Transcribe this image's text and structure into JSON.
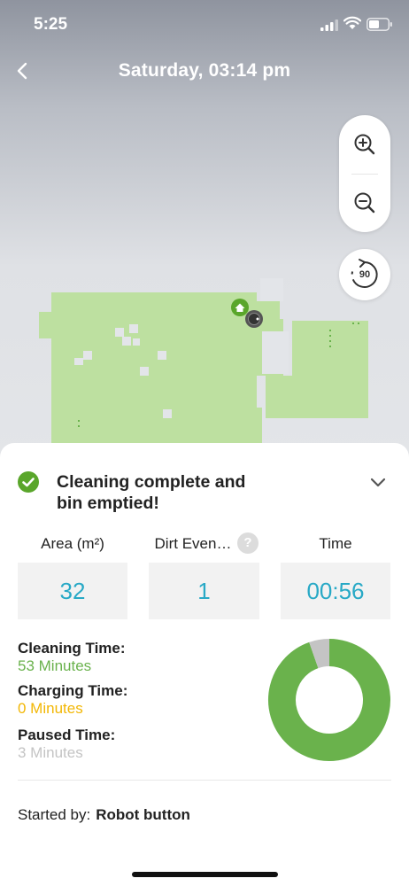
{
  "status_bar": {
    "time": "5:25"
  },
  "header": {
    "title": "Saturday, 03:14 pm"
  },
  "map_controls": {
    "rotate_label": "90"
  },
  "summary": {
    "title_line1": "Cleaning complete and",
    "title_line2": "bin emptied!"
  },
  "stats": [
    {
      "label": "Area (m²)",
      "value": "32"
    },
    {
      "label": "Dirt Even…",
      "value": "1"
    },
    {
      "label": "Time",
      "value": "00:56"
    }
  ],
  "help_glyph": "?",
  "details": {
    "cleaning": {
      "label": "Cleaning Time:",
      "value": "53 Minutes",
      "minutes": 53,
      "color": "#6ab24c"
    },
    "charging": {
      "label": "Charging Time:",
      "value": "0 Minutes",
      "minutes": 0,
      "color": "#f2b705"
    },
    "paused": {
      "label": "Paused Time:",
      "value": "3 Minutes",
      "minutes": 3,
      "color": "#c4c4c4"
    }
  },
  "started_by": {
    "label": "Started by:",
    "value": "Robot button"
  },
  "colors": {
    "accent_teal": "#28a9c6",
    "map_green": "#bde0a0",
    "success_green": "#5aa62b"
  }
}
